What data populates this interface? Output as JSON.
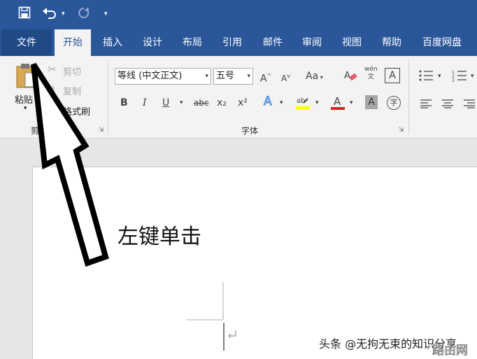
{
  "qat": {
    "save_icon": "save-icon",
    "undo_icon": "undo-icon",
    "redo_icon": "redo-icon",
    "customize_icon": "customize-icon"
  },
  "tabs": [
    "文件",
    "开始",
    "插入",
    "设计",
    "布局",
    "引用",
    "邮件",
    "审阅",
    "视图",
    "帮助",
    "百度网盘"
  ],
  "clipboard": {
    "paste": "粘贴",
    "cut": "剪切",
    "copy": "复制",
    "format_painter": "格式刷",
    "label": "剪贴板"
  },
  "font": {
    "name": "等线 (中文正文)",
    "size": "五号",
    "label": "字体",
    "grow": "A",
    "shrink": "A",
    "case": "Aa",
    "bold": "B",
    "italic": "I",
    "underline": "U",
    "strike": "abc",
    "sub": "x₂",
    "sup": "x²",
    "wen": "wén"
  },
  "colors": {
    "highlight": "#ffff00",
    "font_color": "#e02020",
    "accent": "#2b579a"
  },
  "annotation": "左键单击",
  "watermark": "头条 @无拘无束的知识分享",
  "watermark2": "路由网"
}
